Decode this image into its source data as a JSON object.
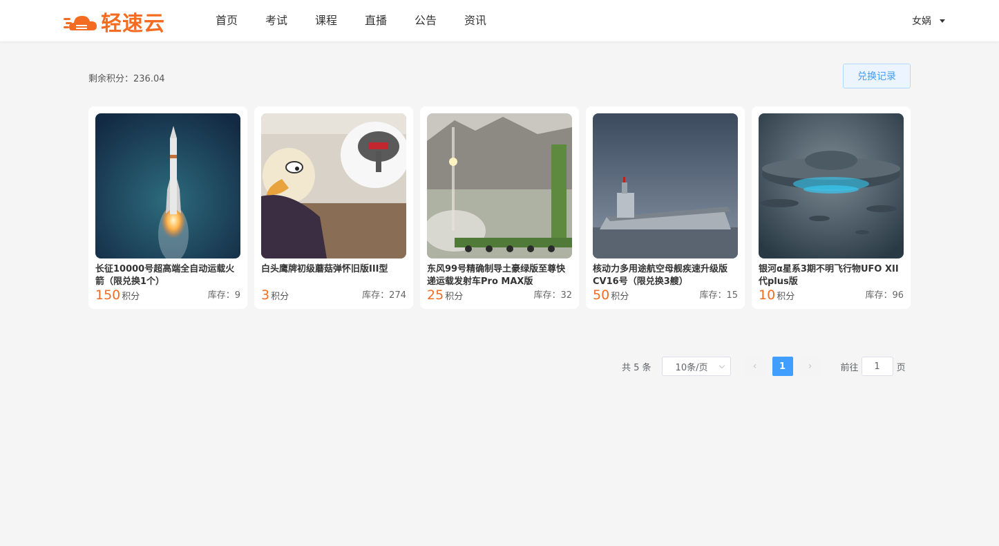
{
  "header": {
    "logo_text": "轻速云",
    "brand_color": "#f46c22",
    "nav": [
      "首页",
      "考试",
      "课程",
      "直播",
      "公告",
      "资讯"
    ],
    "user_name": "女娲"
  },
  "toolbar": {
    "points_label": "剩余积分：236.04",
    "exchange_button": "兑换记录"
  },
  "products": [
    {
      "title": "长征10000号超高端全自动运载火箭（限兑换1个）",
      "price": "150",
      "unit": "积分",
      "stock": "库存：9",
      "image": "rocket-launch"
    },
    {
      "title": "白头鹰牌初级蘑菇弹怀旧版III型",
      "price": "3",
      "unit": "积分",
      "stock": "库存：274",
      "image": "eagle-cartoon"
    },
    {
      "title": "东风99号精确制导土豪绿版至尊快递运载发射车Pro MAX版",
      "price": "25",
      "unit": "积分",
      "stock": "库存：32",
      "image": "missile-launcher"
    },
    {
      "title": "核动力多用途航空母舰疾速升级版CV16号（限兑换3艘）",
      "price": "50",
      "unit": "积分",
      "stock": "库存：15",
      "image": "aircraft-carrier"
    },
    {
      "title": "银河α星系3期不明飞行物UFO XII代plus版",
      "price": "10",
      "unit": "积分",
      "stock": "库存：96",
      "image": "ufo"
    }
  ],
  "pagination": {
    "total": "共 5 条",
    "page_size": "10条/页",
    "current_page": "1",
    "goto_label": "前往",
    "goto_value": "1",
    "page_suffix": "页"
  }
}
